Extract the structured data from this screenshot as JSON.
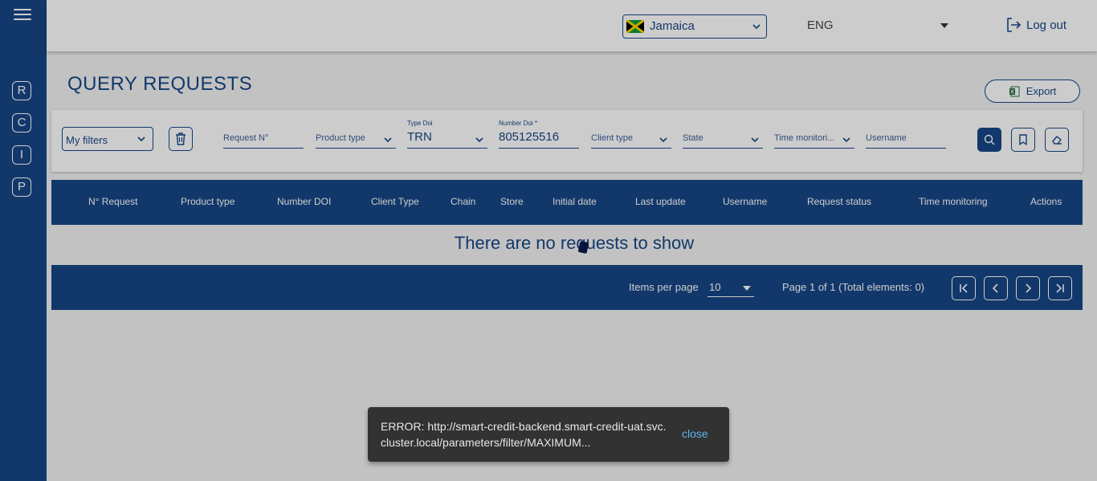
{
  "sidebar": {
    "items": [
      {
        "label": "R"
      },
      {
        "label": "C"
      },
      {
        "label": "I"
      },
      {
        "label": "P"
      }
    ]
  },
  "header": {
    "country": "Jamaica",
    "language": "ENG",
    "logout_label": "Log out"
  },
  "page": {
    "title": "QUERY REQUESTS",
    "export_label": "Export"
  },
  "filters": {
    "my_filters_label": "My filters",
    "request_no_placeholder": "Request N°",
    "product_type_placeholder": "Product type",
    "type_doi_label": "Type Doi",
    "type_doi_value": "TRN",
    "number_doi_label": "Number Doi *",
    "number_doi_value": "805125516",
    "client_type_placeholder": "Client type",
    "state_placeholder": "State",
    "time_monitoring_placeholder": "Time monitori...",
    "username_placeholder": "Username"
  },
  "table": {
    "columns": [
      "N° Request",
      "Product type",
      "Number DOI",
      "Client Type",
      "Chain",
      "Store",
      "Initial date",
      "Last update",
      "Username",
      "Request status",
      "Time monitoring",
      "Actions"
    ],
    "empty_message": "There are no requests to show"
  },
  "pagination": {
    "items_per_page_label": "Items per page",
    "items_per_page_value": "10",
    "page_info": "Page 1 of 1 (Total elements: 0)"
  },
  "snackbar": {
    "message": "ERROR: http://smart-credit-backend.smart-credit-uat.svc.cluster.local/parameters/filter/MAXIMUM...",
    "close_label": "close"
  },
  "colors": {
    "primary": "#174786",
    "snackbar_bg": "#323232",
    "snackbar_action": "#5ab4e6"
  }
}
